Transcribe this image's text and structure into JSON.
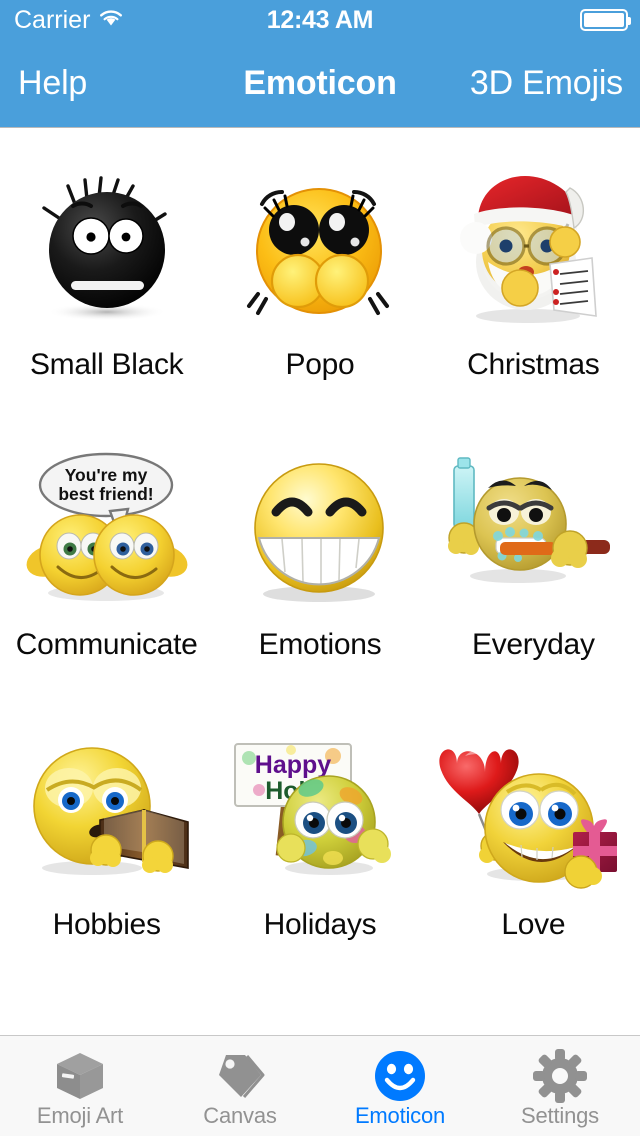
{
  "status_bar": {
    "carrier": "Carrier",
    "wifi_icon": "wifi-icon",
    "time": "12:43 AM",
    "battery_icon": "battery-full-icon",
    "battery_level": 100
  },
  "nav_bar": {
    "left_button": "Help",
    "title": "Emoticon",
    "right_button": "3D Emojis",
    "background_color": "#4a9fdb",
    "text_color": "#ffffff"
  },
  "grid": {
    "items": [
      {
        "label": "Small Black",
        "icon": "small-black-emoticon"
      },
      {
        "label": "Popo",
        "icon": "popo-emoticon"
      },
      {
        "label": "Christmas",
        "icon": "christmas-santa-emoticon"
      },
      {
        "label": "Communicate",
        "icon": "communicate-emoticon",
        "speech_line1": "You're my",
        "speech_line2": "best friend!"
      },
      {
        "label": "Emotions",
        "icon": "emotions-grin-emoticon"
      },
      {
        "label": "Everyday",
        "icon": "everyday-toothbrush-emoticon"
      },
      {
        "label": "Hobbies",
        "icon": "hobbies-reading-emoticon"
      },
      {
        "label": "Holidays",
        "icon": "holidays-holi-emoticon",
        "sign_line1": "Happy",
        "sign_line2": "Holi!"
      },
      {
        "label": "Love",
        "icon": "love-heart-gift-emoticon"
      }
    ]
  },
  "tab_bar": {
    "active_color": "#007aff",
    "inactive_color": "#929292",
    "tabs": [
      {
        "label": "Emoji Art",
        "icon": "box-icon",
        "active": false
      },
      {
        "label": "Canvas",
        "icon": "tag-icon",
        "active": false
      },
      {
        "label": "Emoticon",
        "icon": "smiley-icon",
        "active": true
      },
      {
        "label": "Settings",
        "icon": "gear-icon",
        "active": false
      }
    ]
  }
}
